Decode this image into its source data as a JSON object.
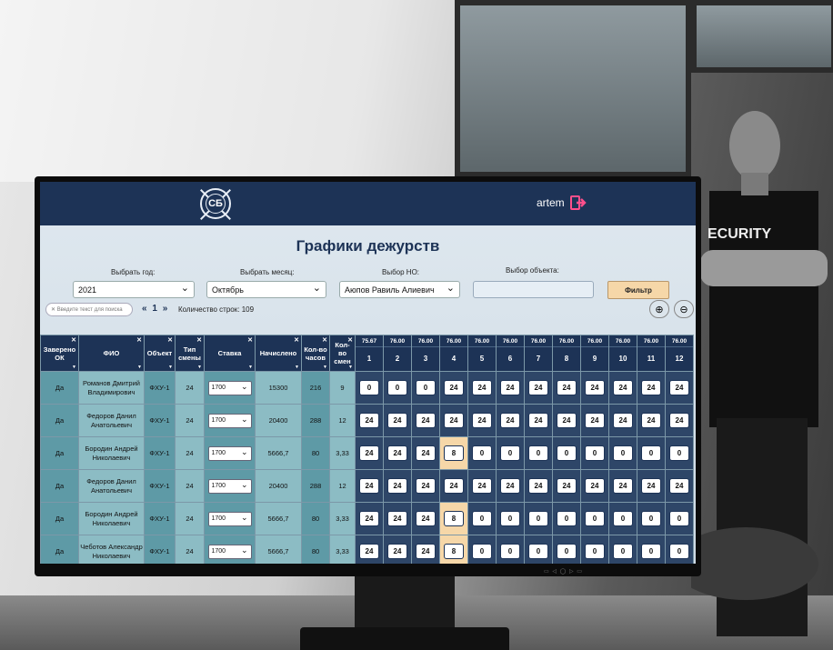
{
  "app": {
    "logo_text": "СБ",
    "user": "artem",
    "page_title": "Графики дежурств"
  },
  "filters": {
    "year_label": "Выбрать год:",
    "year_value": "2021",
    "month_label": "Выбрать месяц:",
    "month_value": "Октябрь",
    "ho_label": "Выбор НО:",
    "ho_value": "Аюпов Равиль Алиевич",
    "object_label": "Выбор объекта:",
    "object_value": "",
    "filter_button": "Фильтр"
  },
  "toolbar": {
    "search_placeholder": "Введите текст для поиска",
    "pager_prev": "«",
    "pager_page": "1",
    "pager_next": "»",
    "row_count": "Количество строк: 109"
  },
  "table": {
    "headers": [
      "Заверено ОК",
      "ФИО",
      "Объект",
      "Тип смены",
      "Ставка",
      "Начислено",
      "Кол-во часов",
      "Кол-во смен"
    ],
    "day_rates": [
      "75.67",
      "76.00",
      "76.00",
      "76.00",
      "76.00",
      "76.00",
      "76.00",
      "76.00",
      "76.00",
      "76.00",
      "76.00",
      "76.00"
    ],
    "day_numbers": [
      "1",
      "2",
      "3",
      "4",
      "5",
      "6",
      "7",
      "8",
      "9",
      "10",
      "11",
      "12"
    ],
    "rows": [
      {
        "verified": "Да",
        "name": "Романов Дмитрий Владимирович",
        "object": "ФХУ-1",
        "shift": "24",
        "rate": "1700",
        "accrued": "15300",
        "hours": "216",
        "shifts": "9",
        "days": [
          "0",
          "0",
          "0",
          "24",
          "24",
          "24",
          "24",
          "24",
          "24",
          "24",
          "24",
          "24"
        ]
      },
      {
        "verified": "Да",
        "name": "Федоров Данил Анатольевич",
        "object": "ФХУ-1",
        "shift": "24",
        "rate": "1700",
        "accrued": "20400",
        "hours": "288",
        "shifts": "12",
        "days": [
          "24",
          "24",
          "24",
          "24",
          "24",
          "24",
          "24",
          "24",
          "24",
          "24",
          "24",
          "24"
        ]
      },
      {
        "verified": "Да",
        "name": "Бородин Андрей Николаевич",
        "object": "ФХУ-1",
        "shift": "24",
        "rate": "1700",
        "accrued": "5666,7",
        "hours": "80",
        "shifts": "3,33",
        "days": [
          "24",
          "24",
          "24",
          "8",
          "0",
          "0",
          "0",
          "0",
          "0",
          "0",
          "0",
          "0"
        ]
      },
      {
        "verified": "Да",
        "name": "Федоров Данил Анатольевич",
        "object": "ФХУ-1",
        "shift": "24",
        "rate": "1700",
        "accrued": "20400",
        "hours": "288",
        "shifts": "12",
        "days": [
          "24",
          "24",
          "24",
          "24",
          "24",
          "24",
          "24",
          "24",
          "24",
          "24",
          "24",
          "24"
        ]
      },
      {
        "verified": "Да",
        "name": "Бородин Андрей Николаевич",
        "object": "ФХУ-1",
        "shift": "24",
        "rate": "1700",
        "accrued": "5666,7",
        "hours": "80",
        "shifts": "3,33",
        "days": [
          "24",
          "24",
          "24",
          "8",
          "0",
          "0",
          "0",
          "0",
          "0",
          "0",
          "0",
          "0"
        ]
      },
      {
        "verified": "Да",
        "name": "Чеботов Александр Николаевич",
        "object": "ФХУ-1",
        "shift": "24",
        "rate": "1700",
        "accrued": "5666,7",
        "hours": "80",
        "shifts": "3,33",
        "days": [
          "24",
          "24",
          "24",
          "8",
          "0",
          "0",
          "0",
          "0",
          "0",
          "0",
          "0",
          "0"
        ]
      }
    ]
  },
  "background": {
    "shirt_text": "ECURITY"
  },
  "colors": {
    "header_bg": "#1d3356",
    "highlight": "#f6d7a8",
    "teal": "#5e9aa6"
  }
}
